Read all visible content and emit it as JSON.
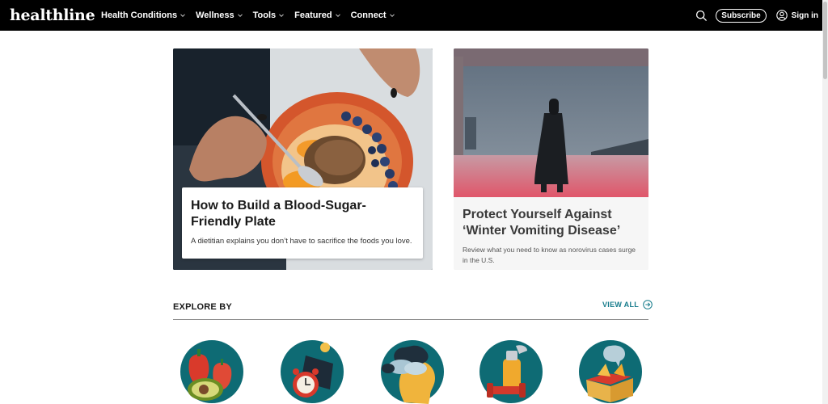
{
  "header": {
    "logo": "healthline",
    "nav": [
      {
        "label": "Health Conditions"
      },
      {
        "label": "Wellness"
      },
      {
        "label": "Tools"
      },
      {
        "label": "Featured"
      },
      {
        "label": "Connect"
      }
    ],
    "subscribe_label": "Subscribe",
    "signin_label": "Sign in",
    "icons": [
      "search-icon",
      "user-icon",
      "chevron-down-icon"
    ]
  },
  "hero": {
    "main": {
      "title": "How to Build a Blood-Sugar-Friendly Plate",
      "description": "A dietitian explains you don’t have to sacrifice the foods you love."
    },
    "secondary": {
      "title": "Protect Yourself Against ‘Winter Vomiting Disease’",
      "description": "Review what you need to know as norovirus cases surge in the U.S."
    }
  },
  "explore": {
    "title": "EXPLORE BY",
    "view_all_label": "VIEW ALL",
    "categories": [
      {
        "icon": "food-vegetables-icon"
      },
      {
        "icon": "sleep-clock-icon"
      },
      {
        "icon": "mental-health-head-icon"
      },
      {
        "icon": "fitness-weights-icon"
      },
      {
        "icon": "product-box-icon"
      }
    ]
  },
  "colors": {
    "header_bg": "#000000",
    "accent": "#177c8c",
    "teal_circle": "#0e6b74"
  }
}
